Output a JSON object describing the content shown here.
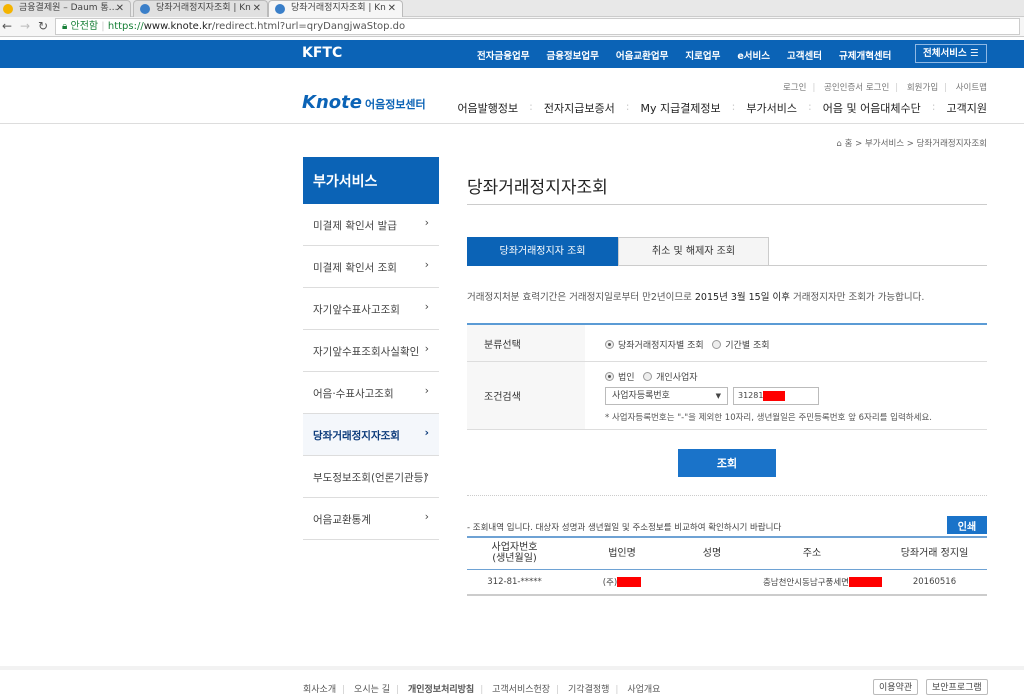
{
  "browser": {
    "tabs": [
      {
        "title": "금융결제원 – Daum 통…"
      },
      {
        "title": "당좌거래정지자조회 | Kn"
      },
      {
        "title": "당좌거래정지자조회 | Kn"
      }
    ],
    "security": "안전함",
    "url_scheme": "https://",
    "url_domain": "www.knote.kr",
    "url_path": "/redirect.html?url=qryDangjwaStop.do"
  },
  "topbar": {
    "brand": "KFTC",
    "menu": [
      "전자금융업무",
      "금융정보업무",
      "어음교환업무",
      "지로업무",
      "e서비스",
      "고객센터",
      "규제개혁센터"
    ],
    "all_services": "전체서비스 ☰"
  },
  "header": {
    "logo": "Knote",
    "logo_sub": "어음정보센터",
    "util": [
      "로그인",
      "공인인증서 로그인",
      "회원가입",
      "사이트맵"
    ],
    "gnb": [
      "어음발행정보",
      "전자지급보증서",
      "My 지급결제정보",
      "부가서비스",
      "어음 및 어음대체수단",
      "고객지원"
    ]
  },
  "breadcrumb": "⌂ 홈 > 부가서비스 > 당좌거래정지자조회",
  "sidebar": {
    "title": "부가서비스",
    "items": [
      {
        "label": "미결제 확인서 발급"
      },
      {
        "label": "미결제 확인서 조회"
      },
      {
        "label": "자기앞수표사고조회"
      },
      {
        "label": "자기앞수표조회사실확인"
      },
      {
        "label": "어음·수표사고조회"
      },
      {
        "label": "당좌거래정지자조회"
      },
      {
        "label": "부도정보조회(언론기관등)"
      },
      {
        "label": "어음교환통계"
      }
    ]
  },
  "main": {
    "title": "당좌거래정지자조회",
    "tabs": [
      "당좌거래정지자 조회",
      "취소 및 해제자 조회"
    ],
    "notice_pre": "거래정지처분 효력기간은 거래정지일로부터 만2년이므로 ",
    "notice_bold": "2015년 3월 15일 이후",
    "notice_post": " 거래정지자만 조회가 가능합니다.",
    "form": {
      "category_label": "분류선택",
      "category_options": [
        "당좌거래정지자별 조회",
        "기간별 조회"
      ],
      "search_label": "조건검색",
      "type_options": [
        "법인",
        "개인사업자"
      ],
      "select_value": "사업자등록번호",
      "input_value": "31281",
      "hint": "* 사업자등록번호는 \"-\"을 제외한 10자리, 생년월일은 주민등록번호 앞 6자리를 입력하세요."
    },
    "search_button": "조회",
    "result_note": "- 조회내역 입니다. 대상자 성명과 생년월일 및 주소정보를 비교하여 확인하시기 바랍니다",
    "print_button": "인쇄",
    "columns": [
      "사업자번호\n(생년월일)",
      "법인명",
      "성명",
      "주소",
      "당좌거래 정지일"
    ],
    "rows": [
      {
        "bizno": "312-81-*****",
        "corp": "(주)",
        "name": "",
        "addr": "충남천안시동남구풍세면",
        "date": "20160516"
      }
    ]
  },
  "footer": {
    "links": [
      "회사소개",
      "오시는 길",
      "개인정보처리방침",
      "고객서비스헌장",
      "기각결정행",
      "사업개요"
    ],
    "buttons": [
      "이용약관",
      "보안프로그램"
    ]
  },
  "colors": {
    "brand": "#0b63b6",
    "redaction": "#ff0000"
  }
}
